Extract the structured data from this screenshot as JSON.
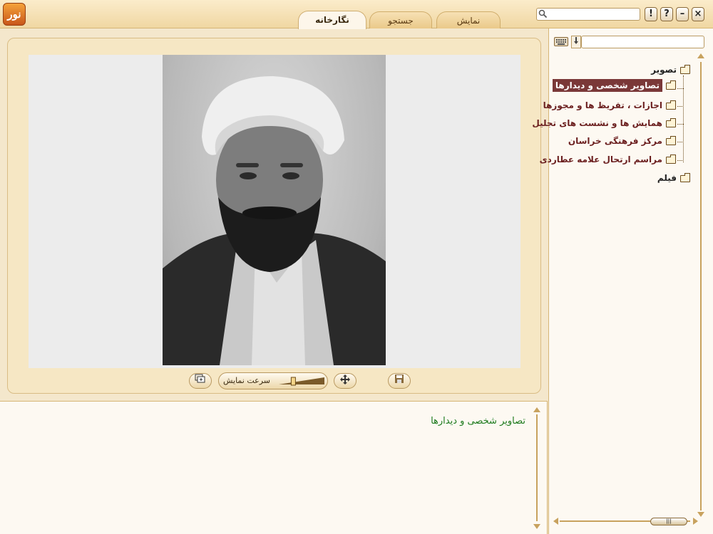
{
  "header": {
    "logo_text": "نور",
    "tabs": [
      {
        "label": "نگارخانه",
        "active": true
      },
      {
        "label": "جستجو",
        "active": false
      },
      {
        "label": "نمایش",
        "active": false
      }
    ],
    "search_value": "",
    "buttons": {
      "alert": "!",
      "help": "?",
      "minimize": "–",
      "close": "×"
    }
  },
  "viewer": {
    "speed_label": "سرعت نمایش",
    "slider_level": 0.3
  },
  "caption": {
    "text": "تصاویر شخصی و دیدارها"
  },
  "tree": {
    "search_value": "",
    "root_images": "تصویر",
    "children": [
      {
        "label": "تصاویر شخصی و دیدارها",
        "selected": true
      },
      {
        "label": "اجازات ، تقریظ ها و مجوزها",
        "selected": false
      },
      {
        "label": "همایش ها و نشست های تجلیل",
        "selected": false
      },
      {
        "label": "مرکز فرهنگی خراسان",
        "selected": false
      },
      {
        "label": "مراسم ارتحال علامه عطاردی",
        "selected": false
      }
    ],
    "root_film": "فیلم"
  },
  "colors": {
    "accent": "#7a3838",
    "caption_green": "#1d7a1d",
    "panel": "#f6e7c4"
  }
}
